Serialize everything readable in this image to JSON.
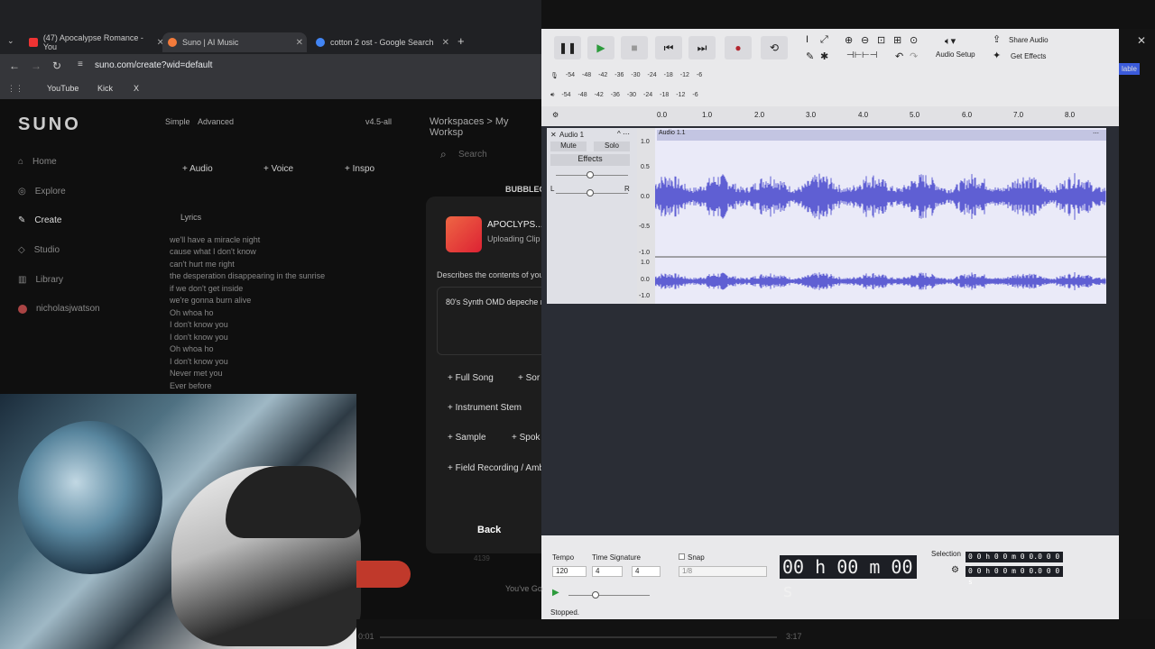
{
  "tabs": [
    {
      "label": "(47) Apocalypse Romance - You"
    },
    {
      "label": "Suno | AI Music"
    },
    {
      "label": "cotton 2 ost - Google Search"
    }
  ],
  "url": "suno.com/create?wid=default",
  "bookmarks": [
    "YouTube",
    "Kick",
    "X"
  ],
  "suno": {
    "logo": "SUNO",
    "mode": {
      "simple": "Simple",
      "advanced": "Advanced"
    },
    "version": "v4.5-all",
    "breadcrumb": "Workspaces > My Worksp",
    "search": "Search",
    "nav": [
      "Home",
      "Explore",
      "Create",
      "Studio",
      "Library",
      "nicholasjwatson"
    ],
    "add": {
      "audio": "+ Audio",
      "voice": "+ Voice",
      "inspo": "+ Inspo"
    },
    "lyrics_label": "Lyrics",
    "lyrics": [
      "we'll have a miracle night",
      "cause what I don't know",
      "can't hurt me right",
      "the desperation disappearing in the sunrise",
      "if we don't get inside",
      "we're gonna burn alive",
      "Oh whoa ho",
      "I don't know you",
      "I don't know you",
      "Oh whoa ho",
      "I don't know you",
      "Never met you",
      "Ever before"
    ],
    "modal": {
      "title": "APOCLYPS...",
      "status": "Uploading Clip",
      "desc": "Describes the contents of you",
      "prompt": "80's Synth OMD depeche m",
      "opts": [
        "+ Full Song",
        "+ Sor",
        "+ Instrument Stem",
        "+ Sample",
        "+ Spok",
        "+ Field Recording / Ambie"
      ],
      "back": "Back"
    },
    "below": {
      "plays": "4139",
      "row": "You've Go",
      "t1": "0:01",
      "t2": "3:17",
      "bubble": "BUBBLEG"
    }
  },
  "audacity": {
    "setup": "Audio Setup",
    "share": "Share Audio",
    "effects_btn": "Get Effects",
    "meter_ticks": [
      "-54",
      "-48",
      "-42",
      "-36",
      "-30",
      "-24",
      "-18",
      "-12",
      "-6"
    ],
    "ruler": [
      "0.0",
      "1.0",
      "2.0",
      "3.0",
      "4.0",
      "5.0",
      "6.0",
      "7.0",
      "8.0"
    ],
    "track": {
      "name": "Audio 1",
      "clip": "Audio 1.1",
      "mute": "Mute",
      "solo": "Solo",
      "effects": "Effects",
      "l": "L",
      "r": "R"
    },
    "scale": [
      "1.0",
      "0.5",
      "0.0",
      "-0.5",
      "-1.0",
      "1.0",
      "0.0",
      "-1.0"
    ],
    "bottom": {
      "tempo_label": "Tempo",
      "tempo": "120",
      "ts_label": "Time Signature",
      "ts_num": "4",
      "ts_den": "4",
      "snap": "Snap",
      "snap_val": "1/8",
      "time": "00 h 00 m 00 s",
      "selection": "Selection",
      "sel1": "0 0 h 0 0 m 0 0.0 0 0 s",
      "sel2": "0 0 h 0 0 m 0 0.0 0 0 s",
      "status": "Stopped."
    }
  },
  "right_side": {
    "label": "lable"
  }
}
